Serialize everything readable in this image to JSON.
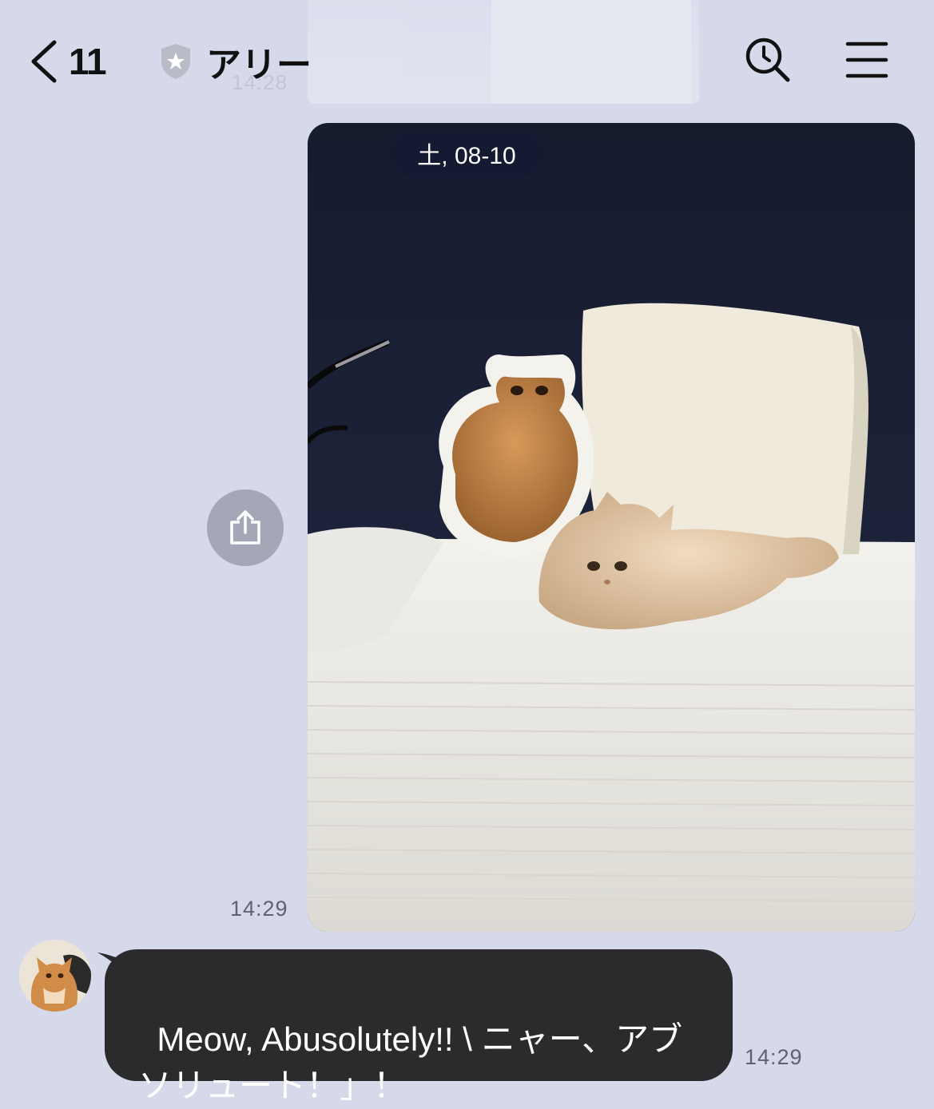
{
  "header": {
    "back_count": "11",
    "title": "アリー",
    "ghost_time": "14:28",
    "icons": {
      "back": "chevron-left-icon",
      "badge": "shield-star-icon",
      "search": "search-history-icon",
      "menu": "hamburger-menu-icon"
    }
  },
  "chat": {
    "date_pill": "土, 08-10",
    "photo_message": {
      "time": "14:29",
      "share_icon": "share-icon"
    },
    "text_message": {
      "text": "Meow, Abusolutely!! \\ ニャー、アブソリュート！」！",
      "time": "14:29"
    }
  },
  "colors": {
    "background": "#d5d9e9",
    "bubble": "#2b2b2e",
    "share_button": "#a4a8b6",
    "time_text": "#5f6270"
  }
}
